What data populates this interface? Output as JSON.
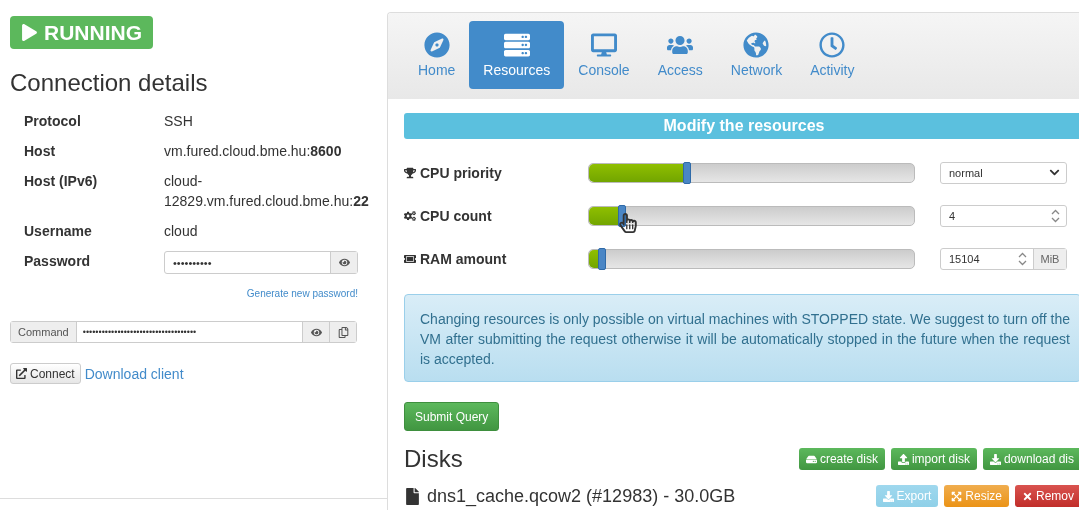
{
  "status": {
    "label": "RUNNING",
    "kind": "running"
  },
  "connection": {
    "title": "Connection details",
    "rows": [
      {
        "label": "Protocol",
        "value": "SSH"
      },
      {
        "label": "Host",
        "value": "vm.fured.cloud.bme.hu:**8600**"
      },
      {
        "label": "Host (IPv6)",
        "value": "cloud-12829.vm.fured.cloud.bme.hu:**22**"
      },
      {
        "label": "Username",
        "value": "cloud"
      }
    ],
    "password": {
      "label": "Password",
      "value": "••••••••••"
    },
    "generate_link": "Generate new password!",
    "command": {
      "label": "Command",
      "value": "••••••••••••••••••••••••••••••••••••"
    },
    "connect_button": "Connect",
    "download_link": "Download client"
  },
  "tabs": [
    {
      "label": "Home",
      "selected": false
    },
    {
      "label": "Resources",
      "selected": true
    },
    {
      "label": "Console",
      "selected": false
    },
    {
      "label": "Access",
      "selected": false
    },
    {
      "label": "Network",
      "selected": false
    },
    {
      "label": "Activity",
      "selected": false
    }
  ],
  "resources": {
    "title": "Modify the resources",
    "rows": [
      {
        "label": "CPU priority",
        "level": 0.3,
        "kind": "select",
        "value": "normal"
      },
      {
        "label": "CPU count",
        "level": 0.1,
        "kind": "number",
        "value": "4",
        "cursor": true
      },
      {
        "label": "RAM amount",
        "level": 0.04,
        "kind": "number_unit",
        "value": "15104",
        "unit": "MiB"
      }
    ],
    "notice": "Changing resources is only possible on virtual machines with STOPPED state. We suggest to turn off the VM after submitting the request otherwise it will be automatically stopped in the future when the request is accepted.",
    "submit": "Submit Query"
  },
  "disks": {
    "title": "Disks",
    "actions": [
      "create disk",
      "import disk",
      "download dis"
    ],
    "items": [
      {
        "name": "dns1_cache.qcow2 (#12983) - 30.0GB",
        "actions": [
          "Export",
          "Resize",
          "Remov"
        ]
      }
    ]
  }
}
